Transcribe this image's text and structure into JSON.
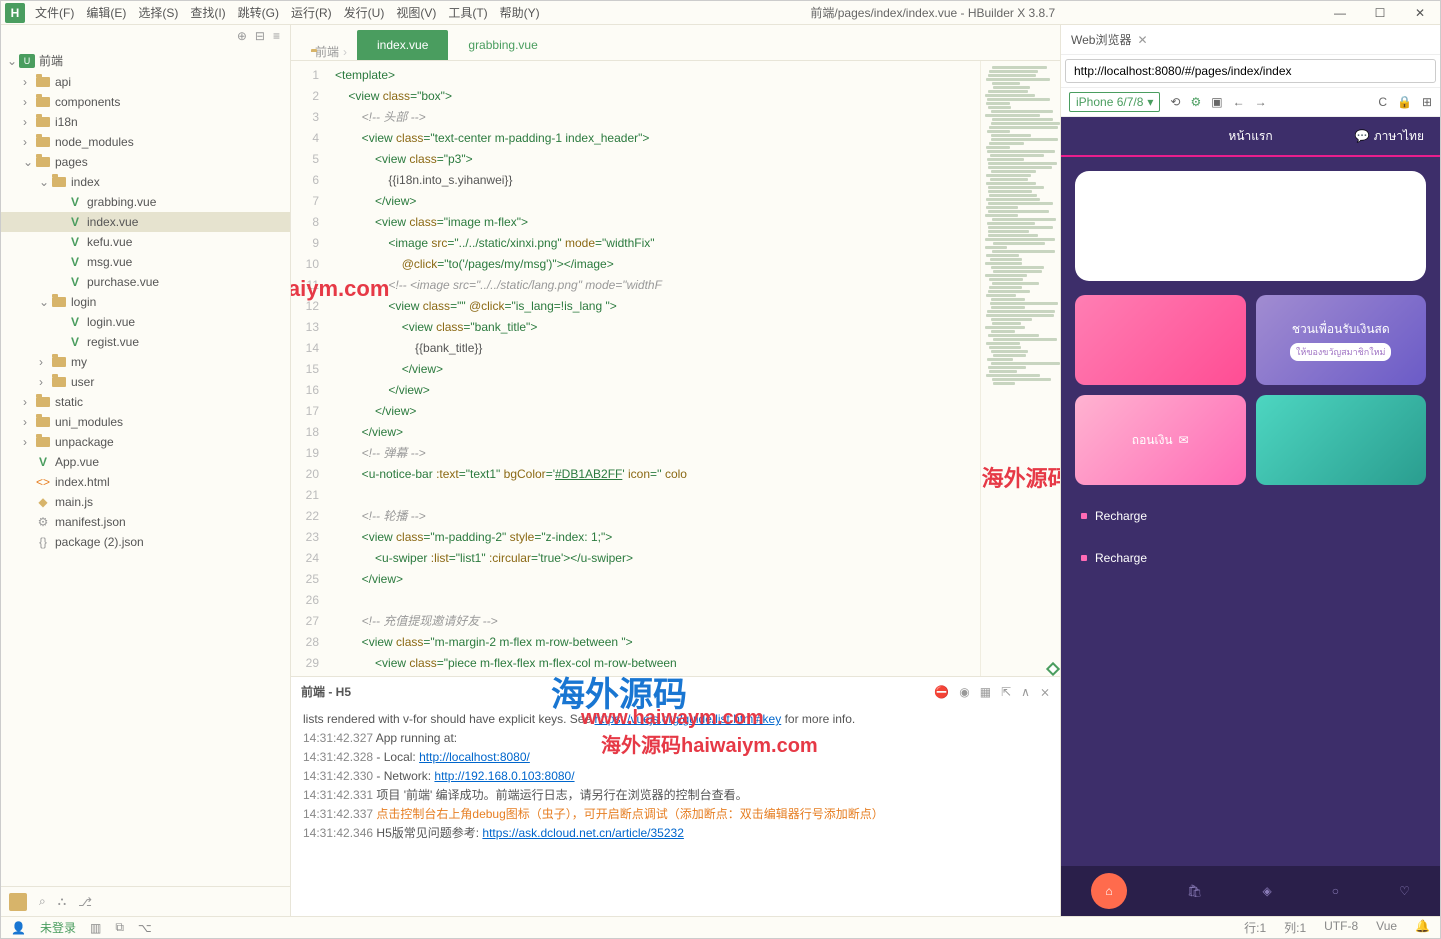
{
  "window_title": "前端/pages/index/index.vue - HBuilder X 3.8.7",
  "menu": [
    "文件(F)",
    "编辑(E)",
    "选择(S)",
    "查找(I)",
    "跳转(G)",
    "运行(R)",
    "发行(U)",
    "视图(V)",
    "工具(T)",
    "帮助(Y)"
  ],
  "sidebar": {
    "root": "前端",
    "items": [
      {
        "label": "api",
        "icon": "folder",
        "indent": 1,
        "chev": "›"
      },
      {
        "label": "components",
        "icon": "folder",
        "indent": 1,
        "chev": "›"
      },
      {
        "label": "i18n",
        "icon": "folder",
        "indent": 1,
        "chev": "›"
      },
      {
        "label": "node_modules",
        "icon": "folder",
        "indent": 1,
        "chev": "›"
      },
      {
        "label": "pages",
        "icon": "folder",
        "indent": 1,
        "chev": "⌄"
      },
      {
        "label": "index",
        "icon": "folder",
        "indent": 2,
        "chev": "⌄"
      },
      {
        "label": "grabbing.vue",
        "icon": "vue",
        "indent": 3,
        "chev": ""
      },
      {
        "label": "index.vue",
        "icon": "vue",
        "indent": 3,
        "chev": "",
        "active": true
      },
      {
        "label": "kefu.vue",
        "icon": "vue",
        "indent": 3,
        "chev": ""
      },
      {
        "label": "msg.vue",
        "icon": "vue",
        "indent": 3,
        "chev": ""
      },
      {
        "label": "purchase.vue",
        "icon": "vue",
        "indent": 3,
        "chev": ""
      },
      {
        "label": "login",
        "icon": "folder",
        "indent": 2,
        "chev": "⌄"
      },
      {
        "label": "login.vue",
        "icon": "vue",
        "indent": 3,
        "chev": ""
      },
      {
        "label": "regist.vue",
        "icon": "vue",
        "indent": 3,
        "chev": ""
      },
      {
        "label": "my",
        "icon": "folder",
        "indent": 2,
        "chev": "›"
      },
      {
        "label": "user",
        "icon": "folder",
        "indent": 2,
        "chev": "›"
      },
      {
        "label": "static",
        "icon": "folder",
        "indent": 1,
        "chev": "›"
      },
      {
        "label": "uni_modules",
        "icon": "folder",
        "indent": 1,
        "chev": "›"
      },
      {
        "label": "unpackage",
        "icon": "folder",
        "indent": 1,
        "chev": "›"
      },
      {
        "label": "App.vue",
        "icon": "vue",
        "indent": 1,
        "chev": ""
      },
      {
        "label": "index.html",
        "icon": "html",
        "indent": 1,
        "chev": ""
      },
      {
        "label": "main.js",
        "icon": "js",
        "indent": 1,
        "chev": ""
      },
      {
        "label": "manifest.json",
        "icon": "gear",
        "indent": 1,
        "chev": ""
      },
      {
        "label": "package (2).json",
        "icon": "brack",
        "indent": 1,
        "chev": ""
      }
    ]
  },
  "tabs": {
    "breadcrumb": "前端",
    "items": [
      {
        "label": "index.vue",
        "active": true
      },
      {
        "label": "grabbing.vue",
        "active": false
      }
    ]
  },
  "code_lines": [
    {
      "n": 1,
      "html": "<span class='t-punc'>&lt;</span><span class='t-tag'>template</span><span class='t-punc'>&gt;</span>"
    },
    {
      "n": 2,
      "fold": true,
      "html": "    <span class='t-punc'>&lt;</span><span class='t-tag'>view</span> <span class='t-attr'>class</span><span class='t-punc'>=</span><span class='t-str'>\"box\"</span><span class='t-punc'>&gt;</span>"
    },
    {
      "n": 3,
      "html": "        <span class='t-comment'>&lt;!-- 头部 --&gt;</span>"
    },
    {
      "n": 4,
      "fold": true,
      "html": "        <span class='t-punc'>&lt;</span><span class='t-tag'>view</span> <span class='t-attr'>class</span><span class='t-punc'>=</span><span class='t-str'>\"text-center m-padding-1 index_header\"</span><span class='t-punc'>&gt;</span>"
    },
    {
      "n": 5,
      "fold": true,
      "html": "            <span class='t-punc'>&lt;</span><span class='t-tag'>view</span> <span class='t-attr'>class</span><span class='t-punc'>=</span><span class='t-str'>\"p3\"</span><span class='t-punc'>&gt;</span>"
    },
    {
      "n": 6,
      "html": "                <span class='t-var'>{{i18n.into_s.yihanwei}}</span>"
    },
    {
      "n": 7,
      "html": "            <span class='t-punc'>&lt;/</span><span class='t-tag'>view</span><span class='t-punc'>&gt;</span>"
    },
    {
      "n": 8,
      "fold": true,
      "html": "            <span class='t-punc'>&lt;</span><span class='t-tag'>view</span> <span class='t-attr'>class</span><span class='t-punc'>=</span><span class='t-str'>\"image m-flex\"</span><span class='t-punc'>&gt;</span>"
    },
    {
      "n": 9,
      "fold": true,
      "html": "                <span class='t-punc'>&lt;</span><span class='t-tag'>image</span> <span class='t-attr'>src</span><span class='t-punc'>=</span><span class='t-str'>\"../../static/xinxi.png\"</span> <span class='t-attr'>mode</span><span class='t-punc'>=</span><span class='t-str'>\"widthFix\"</span>"
    },
    {
      "n": 10,
      "html": "                    <span class='t-attr'>@click</span><span class='t-punc'>=</span><span class='t-str'>\"to('/pages/my/msg')\"</span><span class='t-punc'>&gt;&lt;/</span><span class='t-tag'>image</span><span class='t-punc'>&gt;</span>"
    },
    {
      "n": 11,
      "html": "                <span class='t-comment'>&lt;!-- &lt;image src=\"../../static/lang.png\" mode=\"widthF</span>"
    },
    {
      "n": 12,
      "fold": true,
      "html": "                <span class='t-punc'>&lt;</span><span class='t-tag'>view</span> <span class='t-attr'>class</span><span class='t-punc'>=</span><span class='t-str'>\"\"</span> <span class='t-attr'>@click</span><span class='t-punc'>=</span><span class='t-str'>\"is_lang=!is_lang \"</span><span class='t-punc'>&gt;</span>"
    },
    {
      "n": 13,
      "fold": true,
      "html": "                    <span class='t-punc'>&lt;</span><span class='t-tag'>view</span> <span class='t-attr'>class</span><span class='t-punc'>=</span><span class='t-str'>\"bank_title\"</span><span class='t-punc'>&gt;</span>"
    },
    {
      "n": 14,
      "html": "                        <span class='t-var'>{{bank_title}}</span>"
    },
    {
      "n": 15,
      "html": "                    <span class='t-punc'>&lt;/</span><span class='t-tag'>view</span><span class='t-punc'>&gt;</span>"
    },
    {
      "n": 16,
      "html": "                <span class='t-punc'>&lt;/</span><span class='t-tag'>view</span><span class='t-punc'>&gt;</span>"
    },
    {
      "n": 17,
      "html": "            <span class='t-punc'>&lt;/</span><span class='t-tag'>view</span><span class='t-punc'>&gt;</span>"
    },
    {
      "n": 18,
      "html": "        <span class='t-punc'>&lt;/</span><span class='t-tag'>view</span><span class='t-punc'>&gt;</span>"
    },
    {
      "n": 19,
      "html": "        <span class='t-comment'>&lt;!-- 弹幕 --&gt;</span>"
    },
    {
      "n": 20,
      "html": "        <span class='t-punc'>&lt;</span><span class='t-tag'>u-notice-bar</span> <span class='t-attr'>:text</span><span class='t-punc'>=</span><span class='t-str'>\"text1\"</span> <span class='t-attr'>bgColor</span><span class='t-punc'>=</span><span class='t-str'>'</span><span class='t-color'>#DB1AB2FF</span><span class='t-str'>'</span> <span class='t-attr'>icon</span><span class='t-punc'>=</span><span class='t-str'>''</span> <span class='t-attr'>colo</span>"
    },
    {
      "n": 21,
      "html": ""
    },
    {
      "n": 22,
      "html": "        <span class='t-comment'>&lt;!-- 轮播 --&gt;</span>"
    },
    {
      "n": 23,
      "fold": true,
      "html": "        <span class='t-punc'>&lt;</span><span class='t-tag'>view</span> <span class='t-attr'>class</span><span class='t-punc'>=</span><span class='t-str'>\"m-padding-2\"</span> <span class='t-attr'>style</span><span class='t-punc'>=</span><span class='t-str'>\"z-index: 1;\"</span><span class='t-punc'>&gt;</span>"
    },
    {
      "n": 24,
      "html": "            <span class='t-punc'>&lt;</span><span class='t-tag'>u-swiper</span> <span class='t-attr'>:list</span><span class='t-punc'>=</span><span class='t-str'>\"list1\"</span> <span class='t-attr'>:circular</span><span class='t-punc'>=</span><span class='t-str'>'true'</span><span class='t-punc'>&gt;&lt;/</span><span class='t-tag'>u-swiper</span><span class='t-punc'>&gt;</span>"
    },
    {
      "n": 25,
      "html": "        <span class='t-punc'>&lt;/</span><span class='t-tag'>view</span><span class='t-punc'>&gt;</span>"
    },
    {
      "n": 26,
      "html": ""
    },
    {
      "n": 27,
      "html": "        <span class='t-comment'>&lt;!-- 充值提现邀请好友 --&gt;</span>"
    },
    {
      "n": 28,
      "fold": true,
      "html": "        <span class='t-punc'>&lt;</span><span class='t-tag'>view</span> <span class='t-attr'>class</span><span class='t-punc'>=</span><span class='t-str'>\"m-margin-2 m-flex m-row-between \"</span><span class='t-punc'>&gt;</span>"
    },
    {
      "n": 29,
      "html": "            <span class='t-punc'>&lt;</span><span class='t-tag'>view</span> <span class='t-attr'>class</span><span class='t-punc'>=</span><span class='t-str'>\"piece m-flex-flex m-flex-col m-row-between</span>"
    }
  ],
  "console": {
    "tab": "前端 - H5",
    "lines": [
      {
        "ts": "",
        "text": "  lists rendered with v-for should have explicit keys. See ",
        "link": "https://vuejs.org/guide/list.html#key",
        "after": " for more info."
      },
      {
        "ts": "14:31:42.327",
        "text": "  App running at:"
      },
      {
        "ts": "14:31:42.328",
        "text": "  - Local:   ",
        "link": "http://localhost:8080/"
      },
      {
        "ts": "14:31:42.330",
        "text": "  - Network: ",
        "link": "http://192.168.0.103:8080/"
      },
      {
        "ts": "14:31:42.331",
        "text": " 项目 '前端' 编译成功。前端运行日志，请另行在浏览器的控制台查看。"
      },
      {
        "ts": "14:31:42.337",
        "text": " ",
        "orange": "点击控制台右上角debug图标（虫子），可开启断点调试（添加断点：双击编辑器行号添加断点）"
      },
      {
        "ts": "14:31:42.346",
        "text": " H5版常见问题参考: ",
        "link": "https://ask.dcloud.net.cn/article/35232"
      }
    ]
  },
  "status": {
    "login": "未登录",
    "line": "行:1",
    "col": "列:1",
    "encoding": "UTF-8",
    "lang": "Vue"
  },
  "browser": {
    "tab_title": "Web浏览器",
    "url": "http://localhost:8080/#/pages/index/index",
    "device": "iPhone 6/7/8",
    "header": "หน้าแรก",
    "lang": "ภาษาไทย",
    "card_invite": "ชวนเพื่อนรับเงินสด",
    "card_invite_sub": "ให้ของขวัญสมาชิกใหม่",
    "card_withdraw": "ถอนเงิน",
    "recharge": "Recharge"
  },
  "watermarks": {
    "wm1": "海外源码haiwaiym.com",
    "wm2": "海外源码haiwaiym.com",
    "wm3": "海外源码",
    "wm4": "www.haiwaym.com",
    "wm5": "海外源码haiwaiym.com"
  }
}
